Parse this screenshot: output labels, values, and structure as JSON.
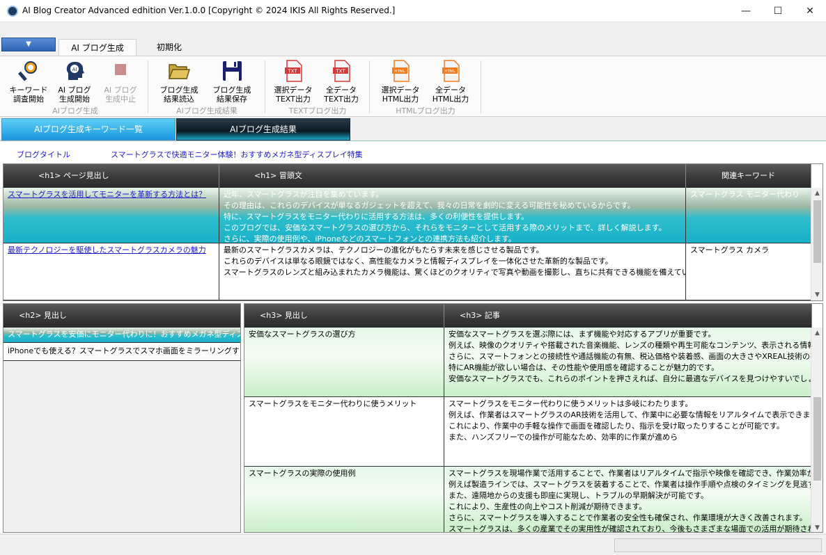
{
  "window": {
    "title": "AI Blog Creator Advanced edhition Ver.1.0.0 [Copyright © 2024 IKIS All Rights Reserved.]",
    "minimize": "—",
    "maximize": "☐",
    "close": "✕"
  },
  "ribbon_tabs": {
    "file_arrow": "▼",
    "tabs": [
      "AI ブログ生成",
      "初期化"
    ]
  },
  "ribbon": {
    "buttons": [
      {
        "line1": "キーワード",
        "line2": "調査開始",
        "icon": "keyword-search-icon"
      },
      {
        "line1": "AI ブログ",
        "line2": "生成開始",
        "icon": "ai-head-icon"
      },
      {
        "line1": "AI ブログ",
        "line2": "生成中止",
        "icon": "stop-icon"
      },
      {
        "line1": "ブログ生成",
        "line2": "結果読込",
        "icon": "open-folder-icon"
      },
      {
        "line1": "ブログ生成",
        "line2": "結果保存",
        "icon": "save-icon"
      },
      {
        "line1": "選択データ",
        "line2": "TEXT出力",
        "icon": "txt-file-icon"
      },
      {
        "line1": "全データ",
        "line2": "TEXT出力",
        "icon": "txt-file-icon"
      },
      {
        "line1": "選択データ",
        "line2": "HTML出力",
        "icon": "html-file-icon"
      },
      {
        "line1": "全データ",
        "line2": "HTML出力",
        "icon": "html-file-icon"
      }
    ],
    "groups": [
      "AIブログ生成",
      "AIブログ生成結果",
      "TEXTブログ出力",
      "HTMLブログ出力"
    ]
  },
  "main_tabs": [
    "AIブログ生成キーワード一覧",
    "AIブログ生成結果"
  ],
  "blog_title": {
    "label": "ブログタイトル",
    "value": "スマートグラスで快適モニター体験！おすすめメガネ型ディスプレイ特集"
  },
  "top_grid": {
    "headers": [
      "<h1> ページ見出し",
      "<h1> 冒頭文",
      "関連キーワード"
    ],
    "rows": [
      {
        "heading": "スマートグラスを活用してモニターを革新する方法とは？",
        "intro": [
          "近年、スマートグラスが注目を集めています。",
          "その理由は、これらのデバイスが単なるガジェットを超えて、我々の日常を劇的に変える可能性を秘めているからです。",
          "特に、スマートグラスをモニター代わりに活用する方法は、多くの利便性を提供します。",
          "このブログでは、安価なスマートグラスの選び方から、それらをモニターとして活用する際のメリットまで、詳しく解説します。",
          "さらに、実際の使用例や、iPhoneなどのスマートフォンとの連携方法も紹介します。"
        ],
        "keywords": "スマートグラス モニター代わり"
      },
      {
        "heading": "最新テクノロジーを駆使したスマートグラスカメラの魅力",
        "intro": [
          "最新のスマートグラスカメラは、テクノロジーの進化がもたらす未来を感じさせる製品です。",
          "これらのデバイスは単なる眼鏡ではなく、高性能なカメラと情報ディスプレイを一体化させた革新的な製品です。",
          "スマートグラスのレンズと組み込まれたカメラ機能は、驚くほどのクオリティで写真や動画を撮影し、直ちに共有できる機能を備えています。"
        ],
        "keywords": "スマートグラス カメラ"
      }
    ]
  },
  "h2_grid": {
    "header": "<h2> 見出し",
    "rows": [
      "スマートグラスを安価にモニター代わりに！おすすめメガネ型ディスプレイとは",
      "iPhoneでも使える？スマートグラスでスマホ画面をミラーリングする方法"
    ]
  },
  "h3_grid": {
    "headers": [
      "<h3> 見出し",
      "<h3> 記事"
    ],
    "rows": [
      {
        "heading": "安価なスマートグラスの選び方",
        "body": [
          "安価なスマートグラスを選ぶ際には、まず機能や対応するアプリが重要です。",
          "例えば、映像のクオリティや搭載された音楽機能、レンズの種類や再生可能なコンテンツ、表示される情報の多様",
          "さらに、スマートフォンとの接続性や通話機能の有無、税込価格や装着感、画面の大きさやXREAL技術の有無も",
          "特にAR機能が欲しい場合は、その性能や使用感を確認することが魅力的です。",
          "安価なスマートグラスでも、これらのポイントを押さえれば、自分に最適なデバイスを見つけやすいでしょう。"
        ]
      },
      {
        "heading": "スマートグラスをモニター代わりに使うメリット",
        "body": [
          "スマートグラスをモニター代わりに使うメリットは多岐にわたります。",
          "例えば、作業者はスマートグラスのAR技術を活用して、作業中に必要な情報をリアルタイムで表示できます。",
          "これにより、作業中の手軽な操作で画面を確認したり、指示を受け取ったりすることが可能です。",
          "また、ハンズフリーでの操作が可能なため、効率的に作業が進めら"
        ]
      },
      {
        "heading": "スマートグラスの実際の使用例",
        "body": [
          "スマートグラスを現場作業で活用することで、作業者はリアルタイムで指示や映像を確認でき、作業効率が大幅に",
          "例えば製造ラインでは、スマートグラスを装着することで、作業者は操作手順や点検のタイミングを見逃すことなく、",
          "また、遠隔地からの支援も即座に実現し、トラブルの早期解決が可能です。",
          "これにより、生産性の向上やコスト削減が期待できます。",
          "さらに、スマートグラスを導入することで作業者の安全性も確保され、作業環境が大きく改善されます。",
          "スマートグラスは、多くの産業でその実用性が確認されており、今後もさまざまな場面での活用が期待されていま"
        ]
      }
    ]
  },
  "colors": {
    "selected_row": "#1ab0c8",
    "header_dark": "#3a3a3a",
    "link_blue": "#1a1acc"
  }
}
